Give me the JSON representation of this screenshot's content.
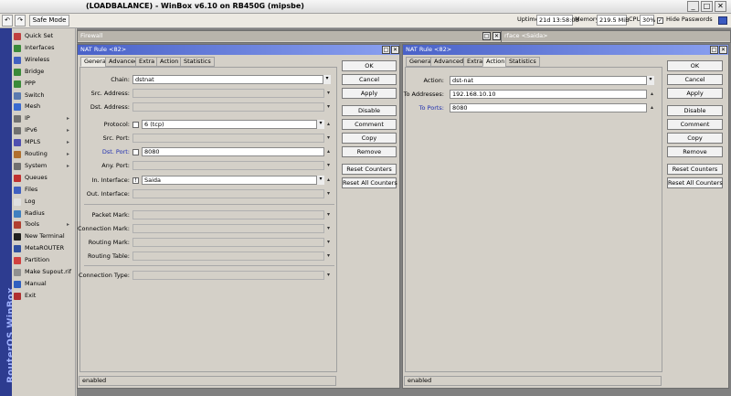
{
  "app": {
    "title": "(LOADBALANCE) - WinBox v6.10 on RB450G (mipsbe)",
    "brand": "RouterOS WinBox"
  },
  "toolbar": {
    "undo_icon": "undo-icon",
    "redo_icon": "redo-icon",
    "safe_mode": "Safe Mode",
    "uptime_label": "Uptime:",
    "uptime_value": "21d 13:58:08",
    "memory_label": "Memory:",
    "memory_value": "219.5 MiB",
    "cpu_label": "CPU:",
    "cpu_value": "30%",
    "hide_passwords": "Hide Passwords"
  },
  "sidebar": {
    "items": [
      {
        "label": "Quick Set",
        "icon": "quick-set-icon",
        "color": "#c04040",
        "arrow": ""
      },
      {
        "label": "Interfaces",
        "icon": "interfaces-icon",
        "color": "#3a8a3a",
        "arrow": ""
      },
      {
        "label": "Wireless",
        "icon": "wireless-icon",
        "color": "#4060c0",
        "arrow": ""
      },
      {
        "label": "Bridge",
        "icon": "bridge-icon",
        "color": "#3a8a3a",
        "arrow": ""
      },
      {
        "label": "PPP",
        "icon": "ppp-icon",
        "color": "#3a8a3a",
        "arrow": ""
      },
      {
        "label": "Switch",
        "icon": "switch-icon",
        "color": "#5a7ab0",
        "arrow": ""
      },
      {
        "label": "Mesh",
        "icon": "mesh-icon",
        "color": "#3a6ad0",
        "arrow": ""
      },
      {
        "label": "IP",
        "icon": "ip-icon",
        "color": "#707070",
        "arrow": "▸"
      },
      {
        "label": "IPv6",
        "icon": "ipv6-icon",
        "color": "#707070",
        "arrow": "▸"
      },
      {
        "label": "MPLS",
        "icon": "mpls-icon",
        "color": "#5050b0",
        "arrow": "▸"
      },
      {
        "label": "Routing",
        "icon": "routing-icon",
        "color": "#b07030",
        "arrow": "▸"
      },
      {
        "label": "System",
        "icon": "system-icon",
        "color": "#707070",
        "arrow": "▸"
      },
      {
        "label": "Queues",
        "icon": "queues-icon",
        "color": "#c03030",
        "arrow": ""
      },
      {
        "label": "Files",
        "icon": "files-icon",
        "color": "#4060c0",
        "arrow": ""
      },
      {
        "label": "Log",
        "icon": "log-icon",
        "color": "#e0e0e0",
        "arrow": ""
      },
      {
        "label": "Radius",
        "icon": "radius-icon",
        "color": "#4080c0",
        "arrow": ""
      },
      {
        "label": "Tools",
        "icon": "tools-icon",
        "color": "#b04030",
        "arrow": "▸"
      },
      {
        "label": "New Terminal",
        "icon": "terminal-icon",
        "color": "#202020",
        "arrow": ""
      },
      {
        "label": "MetaROUTER",
        "icon": "metarouter-icon",
        "color": "#3050a0",
        "arrow": ""
      },
      {
        "label": "Partition",
        "icon": "partition-icon",
        "color": "#d04040",
        "arrow": ""
      },
      {
        "label": "Make Supout.rif",
        "icon": "supout-icon",
        "color": "#909090",
        "arrow": ""
      },
      {
        "label": "Manual",
        "icon": "manual-icon",
        "color": "#3060c0",
        "arrow": ""
      },
      {
        "label": "Exit",
        "icon": "exit-icon",
        "color": "#b03030",
        "arrow": ""
      }
    ]
  },
  "bg_windows": {
    "firewall_title": "Firewall",
    "service_title": "rface <Saida>"
  },
  "left_window": {
    "title": "NAT Rule <82>",
    "tabs": [
      "General",
      "Advanced",
      "Extra",
      "Action",
      "Statistics"
    ],
    "fields": {
      "chain": {
        "label": "Chain:",
        "value": "dstnat"
      },
      "src_address": {
        "label": "Src. Address:",
        "value": ""
      },
      "dst_address": {
        "label": "Dst. Address:",
        "value": ""
      },
      "protocol": {
        "label": "Protocol:",
        "value": "6 (tcp)"
      },
      "src_port": {
        "label": "Src. Port:",
        "value": ""
      },
      "dst_port": {
        "label": "Dst. Port:",
        "value": "8080"
      },
      "any_port": {
        "label": "Any. Port:",
        "value": ""
      },
      "in_interface": {
        "label": "In. Interface:",
        "value": "Saida",
        "prefix": "!"
      },
      "out_interface": {
        "label": "Out. Interface:",
        "value": ""
      },
      "packet_mark": {
        "label": "Packet Mark:",
        "value": ""
      },
      "connection_mark": {
        "label": "Connection Mark:",
        "value": ""
      },
      "routing_mark": {
        "label": "Routing Mark:",
        "value": ""
      },
      "routing_table": {
        "label": "Routing Table:",
        "value": ""
      },
      "connection_type": {
        "label": "Connection Type:",
        "value": ""
      }
    },
    "buttons": [
      "OK",
      "Cancel",
      "Apply",
      "Disable",
      "Comment",
      "Copy",
      "Remove",
      "Reset Counters",
      "Reset All Counters"
    ],
    "status": "enabled"
  },
  "right_window": {
    "title": "NAT Rule <82>",
    "tabs": [
      "General",
      "Advanced",
      "Extra",
      "Action",
      "Statistics"
    ],
    "fields": {
      "action": {
        "label": "Action:",
        "value": "dst-nat"
      },
      "to_addresses": {
        "label": "To Addresses:",
        "value": "192.168.10.10"
      },
      "to_ports": {
        "label": "To Ports:",
        "value": "8080"
      }
    },
    "buttons": [
      "OK",
      "Cancel",
      "Apply",
      "Disable",
      "Comment",
      "Copy",
      "Remove",
      "Reset Counters",
      "Reset All Counters"
    ],
    "status": "enabled"
  },
  "colors": {
    "title_active": "#4a62c8",
    "brand_bar": "#2d3c90",
    "workspace": "#808080",
    "label_blue": "#2030b0"
  }
}
